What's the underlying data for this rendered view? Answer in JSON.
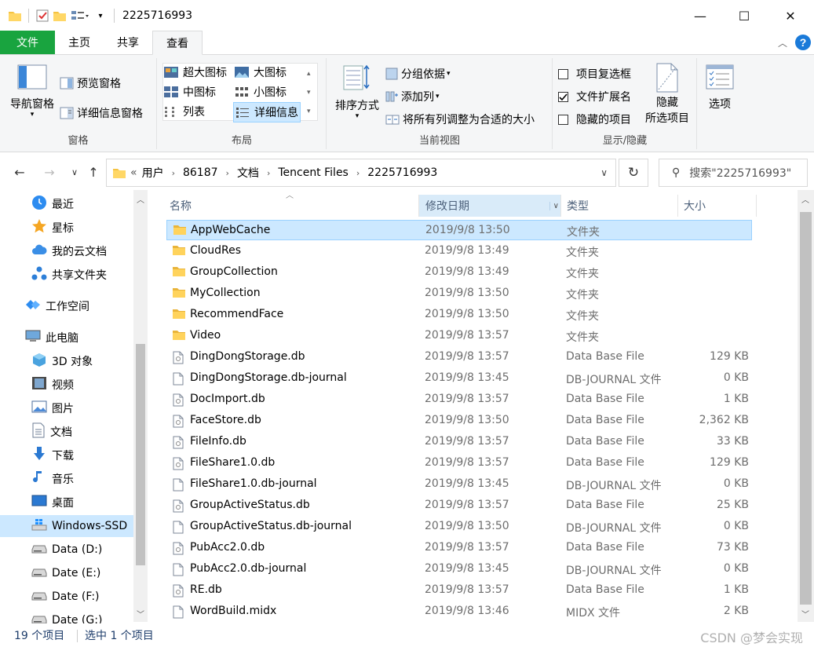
{
  "window": {
    "title": "2225716993",
    "minimize": "—",
    "maximize": "☐",
    "close": "✕"
  },
  "ribbon_tabs": {
    "file": "文件",
    "home": "主页",
    "share": "共享",
    "view": "查看"
  },
  "ribbon": {
    "panes": {
      "nav_pane": "导航窗格",
      "preview_pane": "预览窗格",
      "details_pane": "详细信息窗格",
      "label": "窗格"
    },
    "layout": {
      "xl_icons": "超大图标",
      "large_icons": "大图标",
      "medium_icons": "中图标",
      "small_icons": "小图标",
      "list": "列表",
      "details": "详细信息",
      "label": "布局"
    },
    "current_view": {
      "sort_by": "排序方式",
      "group_by": "分组依据",
      "add_columns": "添加列",
      "fit_columns": "将所有列调整为合适的大小",
      "label": "当前视图"
    },
    "show_hide": {
      "item_checkboxes": "项目复选框",
      "item_checkboxes_checked": false,
      "file_extensions": "文件扩展名",
      "file_extensions_checked": true,
      "hidden_items": "隐藏的项目",
      "hidden_items_checked": false,
      "hide_selected_line1": "隐藏",
      "hide_selected_line2": "所选项目",
      "label": "显示/隐藏"
    },
    "options": "选项"
  },
  "address": {
    "prefix": "«",
    "crumbs": [
      "用户",
      "86187",
      "文档",
      "Tencent Files",
      "2225716993"
    ],
    "search_placeholder": "搜索\"2225716993\""
  },
  "nav_pane": {
    "items": [
      {
        "label": "最近",
        "icon": "clock-icon"
      },
      {
        "label": "星标",
        "icon": "star-icon"
      },
      {
        "label": "我的云文档",
        "icon": "cloud-icon"
      },
      {
        "label": "共享文件夹",
        "icon": "share-icon"
      },
      {
        "label": "工作空间",
        "icon": "workspace-icon"
      },
      {
        "label": "此电脑",
        "icon": "pc-icon"
      },
      {
        "label": "3D 对象",
        "icon": "cube-icon"
      },
      {
        "label": "视频",
        "icon": "video-icon"
      },
      {
        "label": "图片",
        "icon": "picture-icon"
      },
      {
        "label": "文档",
        "icon": "document-icon"
      },
      {
        "label": "下载",
        "icon": "download-icon"
      },
      {
        "label": "音乐",
        "icon": "music-icon"
      },
      {
        "label": "桌面",
        "icon": "desktop-icon"
      },
      {
        "label": "Windows-SSD",
        "icon": "windows-drive-icon"
      },
      {
        "label": "Data (D:)",
        "icon": "drive-icon"
      },
      {
        "label": "Date (E:)",
        "icon": "drive-icon"
      },
      {
        "label": "Date (F:)",
        "icon": "drive-icon"
      },
      {
        "label": "Date (G:)",
        "icon": "drive-icon"
      }
    ]
  },
  "columns": {
    "name": "名称",
    "date": "修改日期",
    "type": "类型",
    "size": "大小"
  },
  "files": [
    {
      "name": "AppWebCache",
      "date": "2019/9/8 13:50",
      "type": "文件夹",
      "size": "",
      "kind": "folder"
    },
    {
      "name": "CloudRes",
      "date": "2019/9/8 13:49",
      "type": "文件夹",
      "size": "",
      "kind": "folder"
    },
    {
      "name": "GroupCollection",
      "date": "2019/9/8 13:49",
      "type": "文件夹",
      "size": "",
      "kind": "folder"
    },
    {
      "name": "MyCollection",
      "date": "2019/9/8 13:50",
      "type": "文件夹",
      "size": "",
      "kind": "folder"
    },
    {
      "name": "RecommendFace",
      "date": "2019/9/8 13:50",
      "type": "文件夹",
      "size": "",
      "kind": "folder"
    },
    {
      "name": "Video",
      "date": "2019/9/8 13:57",
      "type": "文件夹",
      "size": "",
      "kind": "folder"
    },
    {
      "name": "DingDongStorage.db",
      "date": "2019/9/8 13:57",
      "type": "Data Base File",
      "size": "129 KB",
      "kind": "db"
    },
    {
      "name": "DingDongStorage.db-journal",
      "date": "2019/9/8 13:45",
      "type": "DB-JOURNAL 文件",
      "size": "0 KB",
      "kind": "file"
    },
    {
      "name": "DocImport.db",
      "date": "2019/9/8 13:57",
      "type": "Data Base File",
      "size": "1 KB",
      "kind": "db"
    },
    {
      "name": "FaceStore.db",
      "date": "2019/9/8 13:50",
      "type": "Data Base File",
      "size": "2,362 KB",
      "kind": "db"
    },
    {
      "name": "FileInfo.db",
      "date": "2019/9/8 13:57",
      "type": "Data Base File",
      "size": "33 KB",
      "kind": "db"
    },
    {
      "name": "FileShare1.0.db",
      "date": "2019/9/8 13:57",
      "type": "Data Base File",
      "size": "129 KB",
      "kind": "db"
    },
    {
      "name": "FileShare1.0.db-journal",
      "date": "2019/9/8 13:45",
      "type": "DB-JOURNAL 文件",
      "size": "0 KB",
      "kind": "file"
    },
    {
      "name": "GroupActiveStatus.db",
      "date": "2019/9/8 13:57",
      "type": "Data Base File",
      "size": "25 KB",
      "kind": "db"
    },
    {
      "name": "GroupActiveStatus.db-journal",
      "date": "2019/9/8 13:50",
      "type": "DB-JOURNAL 文件",
      "size": "0 KB",
      "kind": "file"
    },
    {
      "name": "PubAcc2.0.db",
      "date": "2019/9/8 13:57",
      "type": "Data Base File",
      "size": "73 KB",
      "kind": "db"
    },
    {
      "name": "PubAcc2.0.db-journal",
      "date": "2019/9/8 13:45",
      "type": "DB-JOURNAL 文件",
      "size": "0 KB",
      "kind": "file"
    },
    {
      "name": "RE.db",
      "date": "2019/9/8 13:57",
      "type": "Data Base File",
      "size": "1 KB",
      "kind": "db"
    },
    {
      "name": "WordBuild.midx",
      "date": "2019/9/8 13:46",
      "type": "MIDX 文件",
      "size": "2 KB",
      "kind": "file"
    }
  ],
  "status": {
    "count": "19 个项目",
    "selected": "选中 1 个项目"
  },
  "watermark": "CSDN @梦会实现",
  "colors": {
    "file_tab": "#19a43f",
    "selection": "#cce8ff",
    "folder": "#f5c342",
    "help": "#1a7ad9"
  }
}
